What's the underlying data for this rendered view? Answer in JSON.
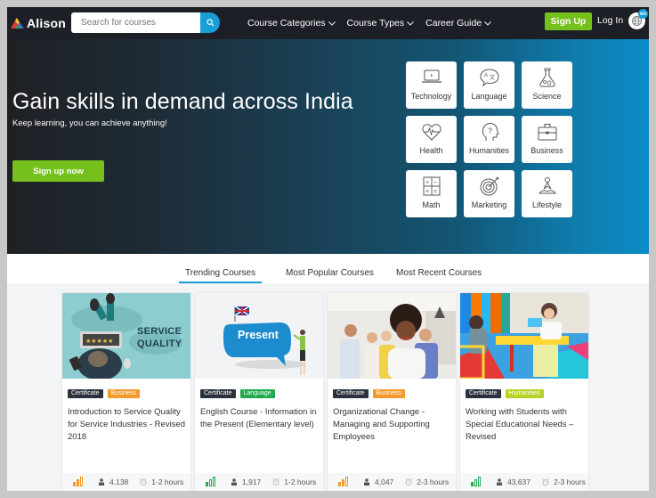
{
  "brand": {
    "name": "Alison"
  },
  "nav": {
    "search_placeholder": "Search for courses",
    "menu": [
      {
        "label": "Course Categories"
      },
      {
        "label": "Course Types"
      },
      {
        "label": "Career Guide"
      }
    ],
    "signup_label": "Sign Up",
    "login_label": "Log In",
    "language_badge": "en"
  },
  "hero": {
    "title": "Gain skills in demand across India",
    "subtitle": "Keep learning, you can achieve anything!",
    "cta_label": "Sign up now",
    "categories": [
      {
        "label": "Technology",
        "icon": "laptop-icon"
      },
      {
        "label": "Language",
        "icon": "translate-bubble-icon"
      },
      {
        "label": "Science",
        "icon": "flask-icon"
      },
      {
        "label": "Health",
        "icon": "heartbeat-icon"
      },
      {
        "label": "Humanities",
        "icon": "head-question-icon"
      },
      {
        "label": "Business",
        "icon": "briefcase-icon"
      },
      {
        "label": "Math",
        "icon": "calculator-icon"
      },
      {
        "label": "Marketing",
        "icon": "target-icon"
      },
      {
        "label": "Lifestyle",
        "icon": "meditation-icon"
      }
    ]
  },
  "tabs": [
    {
      "label": "Trending Courses",
      "active": true
    },
    {
      "label": "Most Popular Courses",
      "active": false
    },
    {
      "label": "Most Recent Courses",
      "active": false
    }
  ],
  "colors": {
    "accent_green": "#76c01e",
    "accent_blue": "#1a9ed8",
    "nav_bg": "#1c1f26",
    "badge_business": "#f39a2b",
    "badge_language": "#1faa4f",
    "badge_humanities": "#b7d12a",
    "level_orange": "#f39a2b",
    "level_green": "#1faa4f"
  },
  "courses": [
    {
      "image_caption": "SERVICE QUALITY",
      "type_badge": "Certificate",
      "category_badge": "Business",
      "title": "Introduction to Service Quality for Service Industries - Revised 2018",
      "level": "intermediate",
      "learners": "4,138",
      "duration": "1-2 hours"
    },
    {
      "image_caption": "Present",
      "type_badge": "Certificate",
      "category_badge": "Language",
      "title": "English Course - Information in the Present (Elementary level)",
      "level": "beginner",
      "learners": "1,917",
      "duration": "1-2 hours"
    },
    {
      "image_caption": "",
      "type_badge": "Certificate",
      "category_badge": "Business",
      "title": "Organizational Change - Managing and Supporting Employees",
      "level": "intermediate",
      "learners": "4,047",
      "duration": "2-3 hours"
    },
    {
      "image_caption": "",
      "type_badge": "Certificate",
      "category_badge": "Humanities",
      "title": "Working with Students with Special Educational Needs – Revised",
      "level": "beginner",
      "learners": "43,637",
      "duration": "2-3 hours"
    }
  ]
}
